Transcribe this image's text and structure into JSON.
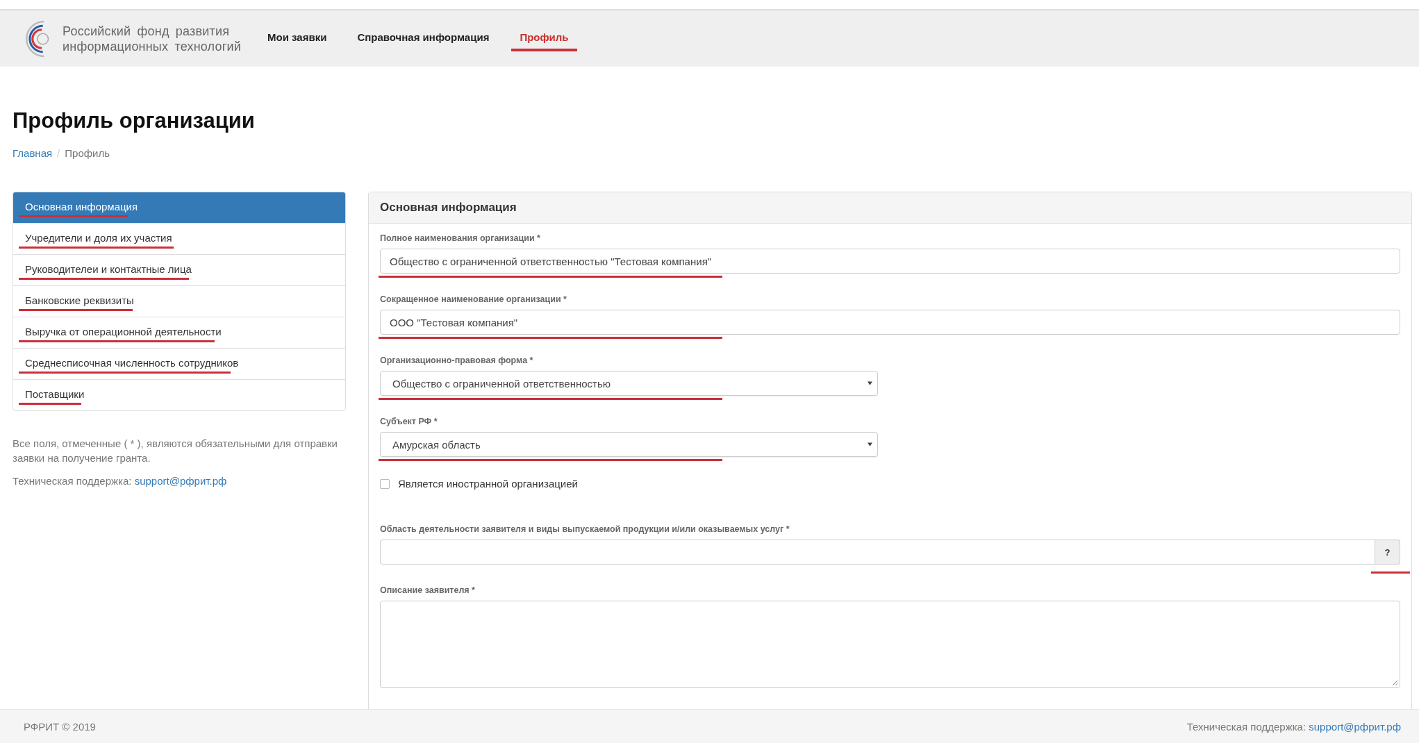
{
  "header": {
    "logo_lines": [
      "Российский фонд развития",
      "информационных технологий"
    ],
    "nav": [
      {
        "label": "Мои заявки",
        "selected": false
      },
      {
        "label": "Справочная информация",
        "selected": false
      },
      {
        "label": "Профиль",
        "selected": true
      }
    ]
  },
  "page_title": "Профиль организации",
  "breadcrumb_separator": "/",
  "breadcrumb": [
    {
      "label": "Главная",
      "kind": "link"
    },
    {
      "label": "Профиль",
      "kind": "current"
    }
  ],
  "sidebar": {
    "items": [
      {
        "label": "Основная информация",
        "selected": true,
        "underlined": true
      },
      {
        "label": "Учредители и доля их участия",
        "selected": false,
        "underlined": true
      },
      {
        "label": "Руководителеи и контактные лица",
        "selected": false,
        "underlined": true
      },
      {
        "label": "Банковские реквизиты",
        "selected": false,
        "underlined": true
      },
      {
        "label": "Выручка от операционной деятельности",
        "selected": false,
        "underlined": true
      },
      {
        "label": "Среднесписочная численность сотрудников",
        "selected": false,
        "underlined": true
      },
      {
        "label": "Поставщики",
        "selected": false,
        "underlined": true
      }
    ]
  },
  "notes": {
    "required_note": "Все поля, отмеченные ( * ), являются обязательными для отправки заявки на получение гранта.",
    "support_label": "Техническая поддержка:",
    "support_link": "support@рфрит.рф"
  },
  "panel": {
    "title": "Основная информация",
    "fields": [
      {
        "kind": "text",
        "label": "Полное наименования организации *",
        "value": "Общество с ограниченной ответственностью \"Тестовая компания\"",
        "underlined": true
      },
      {
        "kind": "text",
        "label": "Сокращенное наименование организации *",
        "value": "ООО \"Тестовая компания\"",
        "underlined": true
      },
      {
        "kind": "select",
        "label": "Организационно-правовая форма *",
        "value": "Общество с ограниченной ответственностью",
        "underlined": true
      },
      {
        "kind": "select",
        "label": "Субъект РФ *",
        "value": "Амурская область",
        "underlined": true
      },
      {
        "kind": "checkbox",
        "label": "Является иностранной организацией",
        "checked": false
      },
      {
        "kind": "help",
        "label": "Область деятельности заявителя и виды выпускаемой продукции и/или оказываемых услуг *",
        "help": "?",
        "underlined": true
      },
      {
        "kind": "textarea",
        "label": "Описание заявителя *"
      }
    ]
  },
  "footer": {
    "copyright": "РФРИТ © 2019",
    "support_label": "Техническая поддержка:",
    "support_link": "support@рфрит.рф"
  }
}
